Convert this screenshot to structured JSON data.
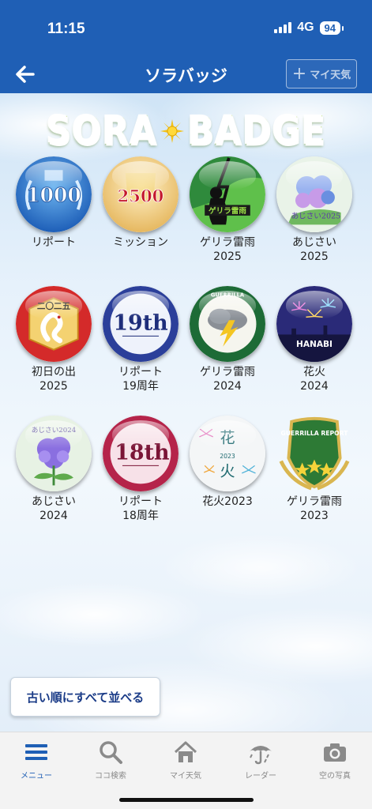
{
  "status": {
    "time": "11:15",
    "network": "4G",
    "battery": "94"
  },
  "nav": {
    "title": "ソラバッジ",
    "my_weather_button": "マイ天気"
  },
  "logo": {
    "left": "SORA",
    "right": "BADGE"
  },
  "badges": [
    {
      "line1": "リポート",
      "line2": "",
      "art": "1000"
    },
    {
      "line1": "ミッション",
      "line2": "",
      "art": "2500"
    },
    {
      "line1": "ゲリラ雷雨",
      "line2": "2025",
      "art": "ゲリラ雷雨"
    },
    {
      "line1": "あじさい",
      "line2": "2025",
      "art": "あじさい2025"
    },
    {
      "line1": "初日の出",
      "line2": "2025",
      "art": "二〇二五"
    },
    {
      "line1": "リポート",
      "line2": "19周年",
      "art": "19th"
    },
    {
      "line1": "ゲリラ雷雨",
      "line2": "2024",
      "art": "GUERRILLA"
    },
    {
      "line1": "花火",
      "line2": "2024",
      "art": "HANABI"
    },
    {
      "line1": "あじさい",
      "line2": "2024",
      "art": "あじさい2024"
    },
    {
      "line1": "リポート",
      "line2": "18周年",
      "art": "18th"
    },
    {
      "line1": "花火2023",
      "line2": "",
      "art": "2023"
    },
    {
      "line1": "ゲリラ雷雨",
      "line2": "2023",
      "art": "GUERRILLA REPORT"
    }
  ],
  "sort_button": "古い順にすべて並べる",
  "tabs": [
    {
      "label": "メニュー",
      "icon": "menu-icon",
      "active": true
    },
    {
      "label": "ココ検索",
      "icon": "search-icon",
      "active": false
    },
    {
      "label": "マイ天気",
      "icon": "home-icon",
      "active": false
    },
    {
      "label": "レーダー",
      "icon": "umbrella-icon",
      "active": false
    },
    {
      "label": "空の写真",
      "icon": "camera-icon",
      "active": false
    }
  ],
  "colors": {
    "header": "#1f5fb5",
    "accent": "#1f5fb5",
    "logo_green": "#8fcd3e",
    "sort_text": "#1a3b87"
  }
}
